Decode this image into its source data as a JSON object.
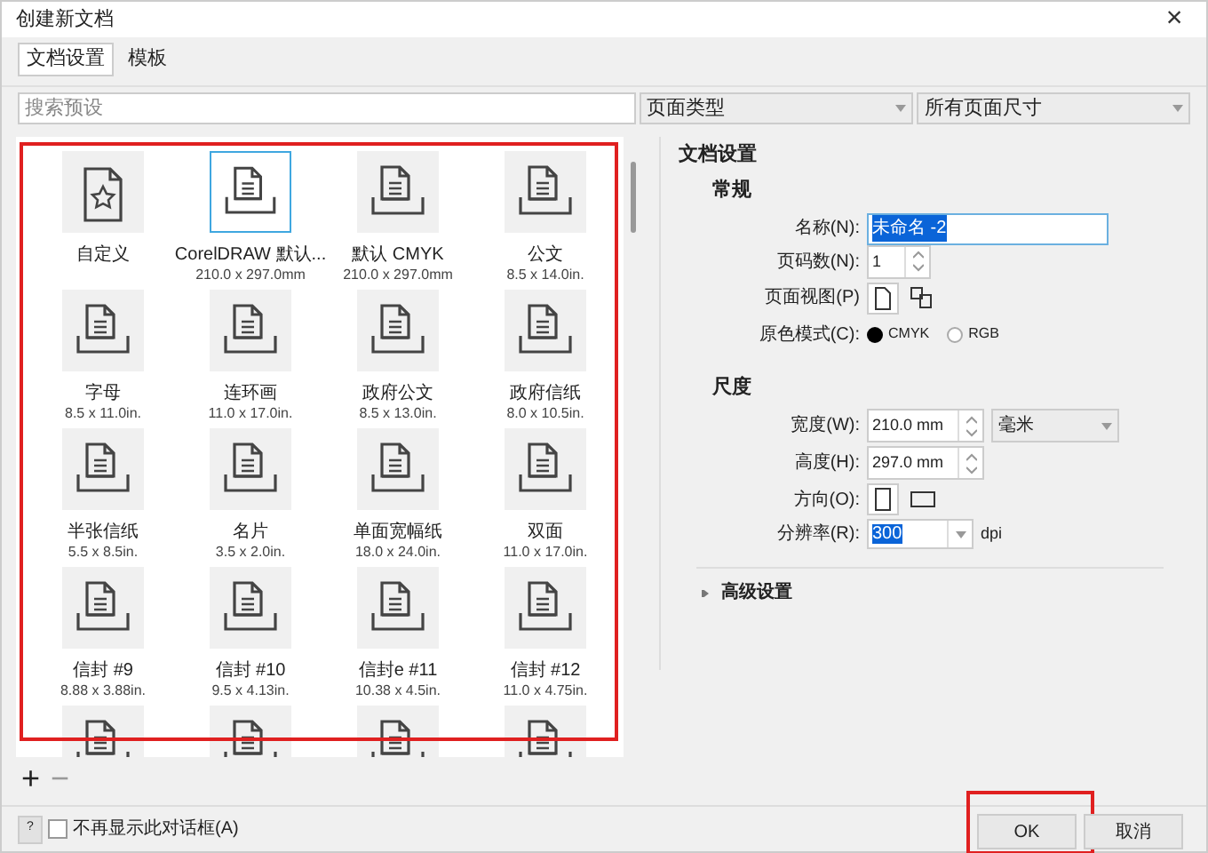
{
  "window": {
    "title": "创建新文档",
    "close": "×"
  },
  "tabs": [
    {
      "label": "文档设置",
      "selected": true
    },
    {
      "label": "模板",
      "selected": false
    }
  ],
  "search": {
    "placeholder": "搜索预设"
  },
  "filters": [
    {
      "value": "页面类型"
    },
    {
      "value": "所有页面尺寸"
    }
  ],
  "presets": {
    "highlight": true,
    "items": [
      {
        "kind": "star",
        "name": "自定义",
        "selected": false
      },
      {
        "kind": "document",
        "name": "CorelDRAW 默认...",
        "size": "210.0 x 297.0mm",
        "selected": true
      },
      {
        "kind": "document",
        "name": "默认 CMYK",
        "size": "210.0 x 297.0mm",
        "selected": false
      },
      {
        "kind": "document",
        "name": "公文",
        "size": "8.5 x 14.0in.",
        "selected": false
      },
      {
        "kind": "document",
        "name": "字母",
        "size": "8.5 x 11.0in.",
        "selected": false
      },
      {
        "kind": "document",
        "name": "连环画",
        "size": "11.0 x 17.0in.",
        "selected": false
      },
      {
        "kind": "document",
        "name": "政府公文",
        "size": "8.5 x 13.0in.",
        "selected": false
      },
      {
        "kind": "document",
        "name": "政府信纸",
        "size": "8.0 x 10.5in.",
        "selected": false
      },
      {
        "kind": "document",
        "name": "半张信纸",
        "size": "5.5 x 8.5in.",
        "selected": false
      },
      {
        "kind": "document",
        "name": "名片",
        "size": "3.5 x 2.0in.",
        "selected": false
      },
      {
        "kind": "document",
        "name": "单面宽幅纸",
        "size": "18.0 x 24.0in.",
        "selected": false
      },
      {
        "kind": "document",
        "name": "双面",
        "size": "11.0 x 17.0in.",
        "selected": false
      },
      {
        "kind": "document",
        "name": "信封 #9",
        "size": "8.88 x 3.88in.",
        "selected": false
      },
      {
        "kind": "document",
        "name": "信封 #10",
        "size": "9.5 x 4.13in.",
        "selected": false
      },
      {
        "kind": "document",
        "name": "信封e #11",
        "size": "10.38 x 4.5in.",
        "selected": false
      },
      {
        "kind": "document",
        "name": "信封 #12",
        "size": "11.0 x 4.75in.",
        "selected": false
      },
      {
        "kind": "document",
        "selected": false
      },
      {
        "kind": "document",
        "selected": false
      },
      {
        "kind": "document",
        "selected": false
      },
      {
        "kind": "document",
        "selected": false
      }
    ]
  },
  "list_tools": [
    {
      "label": "+",
      "disabled": false
    },
    {
      "label": "−",
      "disabled": true
    }
  ],
  "settings": {
    "title": "文档设置",
    "general": {
      "title": "常规",
      "name": {
        "label": "名称(N):",
        "value": "未命名 -2",
        "text_selected": true
      },
      "pages": {
        "label": "页码数(N):",
        "value": "1"
      },
      "page_view": {
        "label": "页面视图(P)",
        "options": [
          {
            "kind": "single",
            "selected": true
          },
          {
            "kind": "multi",
            "selected": false
          }
        ]
      },
      "color_mode": {
        "label": "原色模式(C):",
        "options": [
          {
            "label": "CMYK",
            "selected": true
          },
          {
            "label": "RGB",
            "selected": false
          }
        ]
      }
    },
    "dimensions": {
      "title": "尺度",
      "width": {
        "label": "宽度(W):",
        "value": "210.0 mm"
      },
      "unit": {
        "value": "毫米"
      },
      "height": {
        "label": "高度(H):",
        "value": "297.0 mm"
      },
      "orientation": {
        "label": "方向(O):",
        "options": [
          {
            "kind": "portrait",
            "selected": true
          },
          {
            "kind": "landscape",
            "selected": false
          }
        ]
      },
      "resolution": {
        "label": "分辨率(R):",
        "value": "300",
        "text_selected": true,
        "unit": "dpi"
      }
    },
    "advanced": {
      "label": "高级设置",
      "expanded": false
    }
  },
  "footer": {
    "help": "?",
    "dont_show": {
      "label": "不再显示此对话框(A)",
      "checked": false
    },
    "buttons": [
      {
        "label": "OK",
        "highlight": true
      },
      {
        "label": "取消",
        "highlight": false
      }
    ]
  }
}
